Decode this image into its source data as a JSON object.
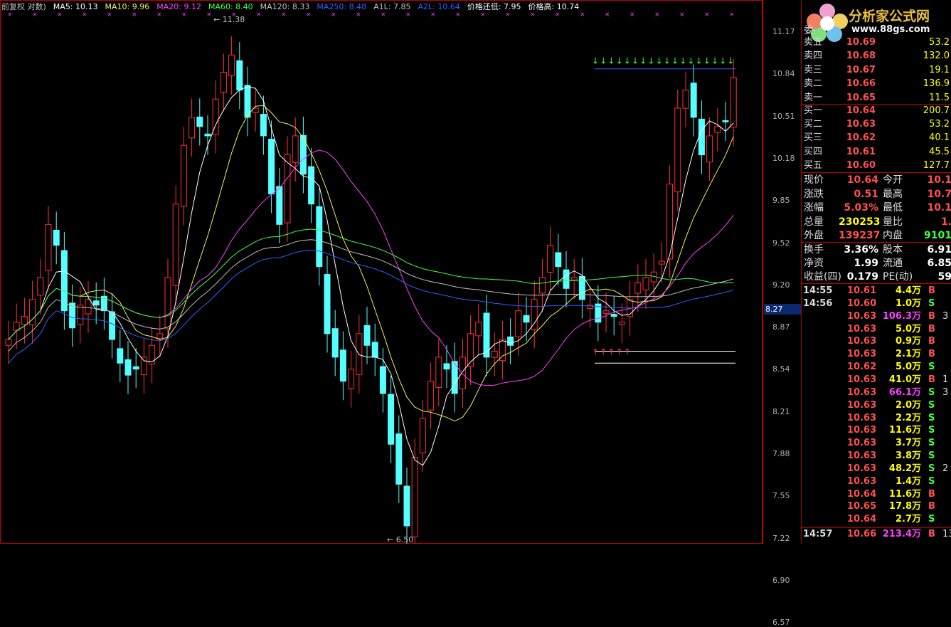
{
  "legend": [
    {
      "text": "前复权 对数)",
      "color": "#c0c0c0"
    },
    {
      "text": "MA5: 10.13",
      "color": "#ffffff"
    },
    {
      "text": "MA10: 9.96",
      "color": "#f0f060"
    },
    {
      "text": "MA20: 9.12",
      "color": "#ff40ff"
    },
    {
      "text": "MA60: 8.40",
      "color": "#40ff40"
    },
    {
      "text": "MA120: 8.33",
      "color": "#c0c0c0"
    },
    {
      "text": "MA250: 8.48",
      "color": "#3060ff"
    },
    {
      "text": "A1L: 7.85",
      "color": "#c0c0c0"
    },
    {
      "text": "A2L: 10.64",
      "color": "#3060ff"
    },
    {
      "text": "价格还低: 7.95",
      "color": "#ffffff"
    },
    {
      "text": "价格高: 10.74",
      "color": "#ffffff"
    }
  ],
  "yaxis": [
    "11.17",
    "10.84",
    "10.51",
    "10.18",
    "9.85",
    "9.52",
    "9.20",
    "8.87",
    "8.54",
    "8.21",
    "7.88",
    "7.55",
    "7.22",
    "6.90",
    "6.57"
  ],
  "current_price_tag": "8.27",
  "annotations": {
    "high": "11.38",
    "low": "6.50"
  },
  "logo": {
    "title": "分析家公式网",
    "url": "www.88gs.com"
  },
  "panel_header": "委",
  "asks": [
    {
      "label": "卖五",
      "price": "10.69",
      "vol": "53.2"
    },
    {
      "label": "卖四",
      "price": "10.68",
      "vol": "132.0"
    },
    {
      "label": "卖三",
      "price": "10.67",
      "vol": "19.1"
    },
    {
      "label": "卖二",
      "price": "10.66",
      "vol": "136.9"
    },
    {
      "label": "卖一",
      "price": "10.65",
      "vol": "11.5"
    }
  ],
  "bids": [
    {
      "label": "买一",
      "price": "10.64",
      "vol": "200.7"
    },
    {
      "label": "买二",
      "price": "10.63",
      "vol": "53.2"
    },
    {
      "label": "买三",
      "price": "10.62",
      "vol": "40.1"
    },
    {
      "label": "买四",
      "price": "10.61",
      "vol": "45.5"
    },
    {
      "label": "买五",
      "price": "10.60",
      "vol": "127.7"
    }
  ],
  "quote": [
    {
      "l1": "现价",
      "v1": "10.64",
      "c1": "#ff5050",
      "l2": "今开",
      "v2": "10.1",
      "c2": "#ff5050"
    },
    {
      "l1": "涨跌",
      "v1": "0.51",
      "c1": "#ff5050",
      "l2": "最高",
      "v2": "10.7",
      "c2": "#ff5050"
    },
    {
      "l1": "涨幅",
      "v1": "5.03%",
      "c1": "#ff5050",
      "l2": "最低",
      "v2": "10.1",
      "c2": "#ff5050"
    },
    {
      "l1": "总量",
      "v1": "230253",
      "c1": "#ffff00",
      "l2": "量比",
      "v2": "1.",
      "c2": "#ff5050"
    },
    {
      "l1": "外盘",
      "v1": "139237",
      "c1": "#ff5050",
      "l2": "内盘",
      "v2": "9101",
      "c2": "#40ff40"
    }
  ],
  "stats": [
    {
      "l1": "换手",
      "v1": "3.36%",
      "l2": "股本",
      "v2": "6.91"
    },
    {
      "l1": "净资",
      "v1": "1.99",
      "l2": "流通",
      "v2": "6.85"
    },
    {
      "l1": "收益(四)",
      "v1": "0.179",
      "l2": "PE(动)",
      "v2": "59"
    }
  ],
  "trades": [
    {
      "t": "14:55",
      "p": "10.61",
      "v": "4.4万",
      "s": "B",
      "x": ""
    },
    {
      "t": "14:56",
      "p": "10.60",
      "v": "1.0万",
      "s": "S",
      "x": ""
    },
    {
      "t": "",
      "p": "10.63",
      "v": "106.3万",
      "s": "B",
      "x": "3"
    },
    {
      "t": "",
      "p": "10.63",
      "v": "5.0万",
      "s": "B",
      "x": ""
    },
    {
      "t": "",
      "p": "10.63",
      "v": "0.9万",
      "s": "B",
      "x": ""
    },
    {
      "t": "",
      "p": "10.63",
      "v": "2.1万",
      "s": "B",
      "x": ""
    },
    {
      "t": "",
      "p": "10.62",
      "v": "5.0万",
      "s": "S",
      "x": ""
    },
    {
      "t": "",
      "p": "10.63",
      "v": "41.0万",
      "s": "B",
      "x": "1"
    },
    {
      "t": "",
      "p": "10.63",
      "v": "66.1万",
      "s": "S",
      "x": "3"
    },
    {
      "t": "",
      "p": "10.63",
      "v": "2.0万",
      "s": "S",
      "x": ""
    },
    {
      "t": "",
      "p": "10.63",
      "v": "2.2万",
      "s": "S",
      "x": ""
    },
    {
      "t": "",
      "p": "10.63",
      "v": "11.6万",
      "s": "S",
      "x": ""
    },
    {
      "t": "",
      "p": "10.63",
      "v": "3.7万",
      "s": "S",
      "x": ""
    },
    {
      "t": "",
      "p": "10.63",
      "v": "3.8万",
      "s": "S",
      "x": ""
    },
    {
      "t": "",
      "p": "10.63",
      "v": "48.2万",
      "s": "S",
      "x": "2"
    },
    {
      "t": "",
      "p": "10.63",
      "v": "1.4万",
      "s": "S",
      "x": ""
    },
    {
      "t": "",
      "p": "10.64",
      "v": "11.6万",
      "s": "B",
      "x": ""
    },
    {
      "t": "",
      "p": "10.65",
      "v": "17.8万",
      "s": "B",
      "x": ""
    },
    {
      "t": "",
      "p": "10.64",
      "v": "2.7万",
      "s": "S",
      "x": ""
    },
    {
      "t": "14:57",
      "p": "10.66",
      "v": "213.4万",
      "s": "B",
      "x": "13"
    }
  ],
  "colors": {
    "up": "#ff3030",
    "down": "#54ffff",
    "bg": "#000000",
    "grid": "#c00000"
  }
}
